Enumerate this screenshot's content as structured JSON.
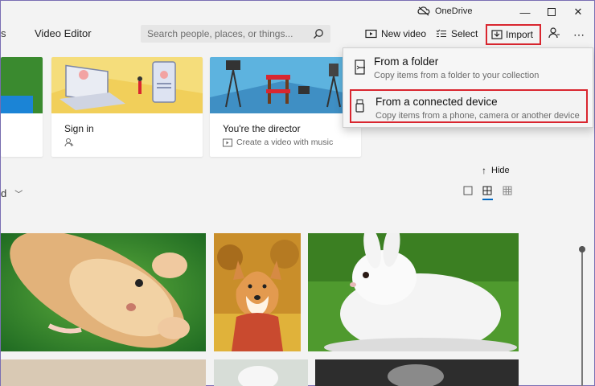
{
  "titlebar": {
    "onedrive_label": "OneDrive"
  },
  "nav": {
    "partial_label": "s",
    "video_editor_label": "Video Editor"
  },
  "search": {
    "placeholder": "Search people, places, or things..."
  },
  "commands": {
    "new_video_label": "New video",
    "select_label": "Select",
    "import_label": "Import"
  },
  "tiles": [
    {
      "title": "Sign in",
      "subtitle": ""
    },
    {
      "title": "You're the director",
      "subtitle": "Create a video with music"
    }
  ],
  "import_menu": {
    "items": [
      {
        "title": "From a folder",
        "subtitle": "Copy items from a folder to your collection"
      },
      {
        "title": "From a connected device",
        "subtitle": "Copy items from a phone, camera or another device"
      }
    ]
  },
  "section": {
    "hide_label": "Hide",
    "sort_partial_label": "d"
  },
  "colors": {
    "highlight_red": "#d9262f",
    "tile_yellow": "#f5dd7b",
    "tile_blue": "#5db3df",
    "accent_blue": "#0067c0"
  }
}
